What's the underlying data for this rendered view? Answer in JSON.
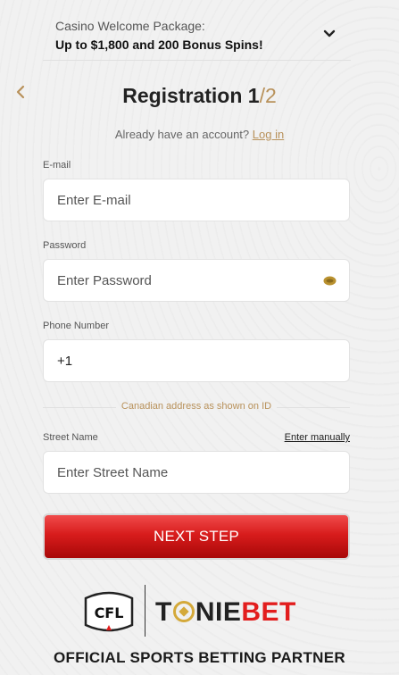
{
  "promo": {
    "title": "Casino Welcome Package:",
    "offer": "Up to $1,800 and 200 Bonus Spins!"
  },
  "header": {
    "title_main": "Registration 1",
    "title_total": "/2",
    "login_prompt": "Already have an account?",
    "login_link": "Log in"
  },
  "form": {
    "email": {
      "label": "E-mail",
      "placeholder": "Enter E-mail"
    },
    "password": {
      "label": "Password",
      "placeholder": "Enter Password"
    },
    "phone": {
      "label": "Phone Number",
      "value": "+1"
    },
    "address_divider": "Canadian address as shown on ID",
    "street": {
      "label": "Street Name",
      "placeholder": "Enter Street Name",
      "manual_link": "Enter manually"
    },
    "next_label": "NEXT STEP"
  },
  "partner": {
    "league_logo_text": "CFL",
    "brand_part1": "T",
    "brand_part2": "NIE",
    "brand_part3": "BET",
    "tagline": "OFFICIAL SPORTS BETTING PARTNER"
  },
  "colors": {
    "accent_gold": "#b8915a",
    "button_red": "#d81c1c",
    "brand_red": "#e21d1d"
  },
  "icons": [
    "chevron-down-icon",
    "back-arrow-icon",
    "eye-icon",
    "cfl-logo"
  ]
}
